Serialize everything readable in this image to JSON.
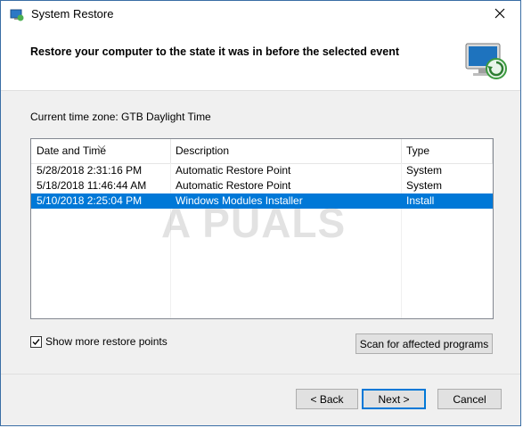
{
  "window": {
    "title": "System Restore"
  },
  "header": {
    "title": "Restore your computer to the state it was in before the selected event"
  },
  "timezone": {
    "text": "Current time zone: GTB Daylight Time"
  },
  "table": {
    "columns": [
      "Date and Time",
      "Description",
      "Type"
    ],
    "rows": [
      {
        "date": "5/28/2018 2:31:16 PM",
        "description": "Automatic Restore Point",
        "type": "System",
        "selected": false
      },
      {
        "date": "5/18/2018 11:46:44 AM",
        "description": "Automatic Restore Point",
        "type": "System",
        "selected": false
      },
      {
        "date": "5/10/2018 2:25:04 PM",
        "description": "Windows Modules Installer",
        "type": "Install",
        "selected": true
      }
    ]
  },
  "watermark": {
    "text": "A PUALS"
  },
  "options": {
    "show_more_label": "Show more restore points",
    "show_more_checked": true
  },
  "buttons": {
    "scan": "Scan for affected programs",
    "back": "< Back",
    "next": "Next >",
    "cancel": "Cancel"
  },
  "colors": {
    "selection": "#0078d7",
    "border": "#3a6ea5"
  },
  "icons": {
    "title": "system-restore-icon",
    "header": "monitor-restore-icon",
    "close": "close-icon"
  }
}
